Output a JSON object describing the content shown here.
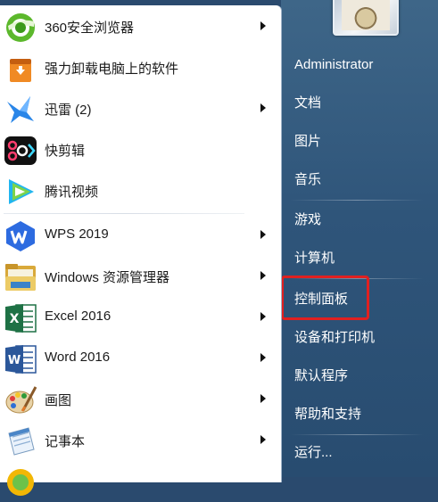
{
  "programs": [
    {
      "id": "360",
      "label": "360安全浏览器",
      "icon": "360-browser-icon",
      "has_arrow": true
    },
    {
      "id": "uninstall",
      "label": "强力卸载电脑上的软件",
      "icon": "uninstaller-icon",
      "has_arrow": false
    },
    {
      "id": "xunlei",
      "label": "迅雷 (2)",
      "icon": "xunlei-icon",
      "has_arrow": true
    },
    {
      "id": "kuaijianji",
      "label": "快剪辑",
      "icon": "kuaijianji-icon",
      "has_arrow": false
    },
    {
      "id": "tencent-video",
      "label": "腾讯视频",
      "icon": "tencent-video-icon",
      "has_arrow": false
    },
    {
      "id": "wps",
      "label": "WPS 2019",
      "icon": "wps-icon",
      "has_arrow": true
    },
    {
      "id": "explorer",
      "label": "Windows 资源管理器",
      "icon": "folder-icon",
      "has_arrow": true
    },
    {
      "id": "excel",
      "label": "Excel 2016",
      "icon": "excel-icon",
      "has_arrow": true
    },
    {
      "id": "word",
      "label": "Word 2016",
      "icon": "word-icon",
      "has_arrow": true
    },
    {
      "id": "paint",
      "label": "画图",
      "icon": "paint-icon",
      "has_arrow": true
    },
    {
      "id": "notepad",
      "label": "记事本",
      "icon": "notepad-icon",
      "has_arrow": true
    }
  ],
  "right_menu": {
    "user": "Administrator",
    "documents": "文档",
    "pictures": "图片",
    "music": "音乐",
    "games": "游戏",
    "computer": "计算机",
    "control_panel": "控制面板",
    "devices_printers": "设备和打印机",
    "default_programs": "默认程序",
    "help_support": "帮助和支持",
    "run": "运行..."
  },
  "colors": {
    "highlight_border": "#e02020",
    "right_pane": "#2f557a"
  }
}
